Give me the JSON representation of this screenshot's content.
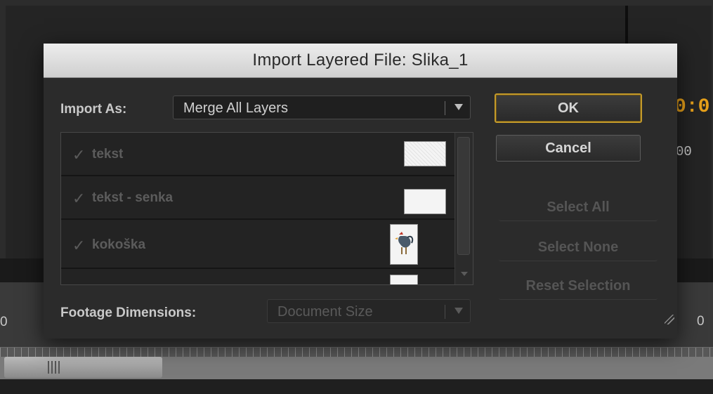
{
  "background": {
    "timecode_partial": "0:0",
    "right_label_partial": "00",
    "left_label_partial": "0",
    "bottom_right_label_partial": "0"
  },
  "dialog": {
    "title": "Import Layered File: Slika_1",
    "import_as": {
      "label": "Import As:",
      "value": "Merge All Layers"
    },
    "layers": [
      {
        "name": "tekst",
        "checked": true
      },
      {
        "name": "tekst - senka",
        "checked": true
      },
      {
        "name": "kokoška",
        "checked": true
      }
    ],
    "footage_dimensions": {
      "label": "Footage Dimensions:",
      "value": "Document Size"
    },
    "buttons": {
      "ok": "OK",
      "cancel": "Cancel",
      "select_all": "Select All",
      "select_none": "Select None",
      "reset_selection": "Reset Selection"
    },
    "check_glyph": "✓"
  },
  "colors": {
    "accent_default_button": "#c49a2a",
    "timecode": "#e6a01a"
  }
}
